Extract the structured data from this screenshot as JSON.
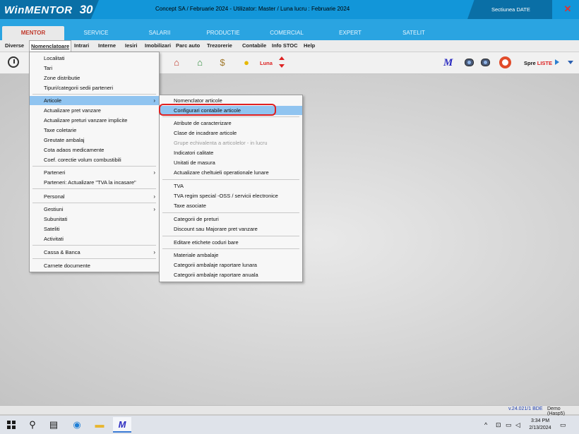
{
  "app": {
    "logo_text": "WinMENTOR",
    "logo_badge": "30",
    "title": "Concept SA / Februarie 2024 - Utilizator: Master / Luna lucru : Februarie 2024",
    "section": "Sectiunea DATE",
    "close_glyph": "✕"
  },
  "modules": [
    "MENTOR",
    "SERVICE",
    "SALARII",
    "PRODUCTIE",
    "COMERCIAL",
    "EXPERT",
    "SATELIT"
  ],
  "menubar": [
    "Diverse",
    "Nomenclatoare",
    "Intrari",
    "Interne",
    "Iesiri",
    "Imobilizari",
    "Parc auto",
    "Trezorerie",
    "Contabile",
    "Info STOC",
    "Help"
  ],
  "toolbar": {
    "luna": "Luna",
    "spre_prefix": "Spre ",
    "spre_accent": "LISTE",
    "icons": [
      "clock-icon",
      "house-icon",
      "house-add-icon",
      "money-bag-icon",
      "lightbulb-icon",
      "m-logo-icon",
      "record-icon",
      "record-icon",
      "lifebuoy-icon"
    ],
    "m_glyph": "M"
  },
  "menu_nomenclatoare": [
    {
      "label": "Localitati"
    },
    {
      "label": "Tari"
    },
    {
      "label": "Zone distributie"
    },
    {
      "label": "Tipuri/categorii sedii parteneri"
    },
    {
      "label": "Articole",
      "arrow": "›",
      "highlight": true
    },
    {
      "label": "Actualizare pret vanzare"
    },
    {
      "label": "Actualizare preturi vanzare implicite"
    },
    {
      "label": "Taxe coletarie"
    },
    {
      "label": "Greutate ambalaj"
    },
    {
      "label": "Cota adaos medicamente"
    },
    {
      "label": "Coef. corectie volum combustibili"
    },
    {
      "label": "Parteneri",
      "arrow": "›"
    },
    {
      "label": "Parteneri: Actualizare \"TVA la incasare\""
    },
    {
      "label": "Personal",
      "arrow": "›"
    },
    {
      "label": "Gestiuni",
      "arrow": "›"
    },
    {
      "label": "Subunitati"
    },
    {
      "label": "Sateliti"
    },
    {
      "label": "Activitati"
    },
    {
      "label": "Cassa & Banca",
      "arrow": "›"
    },
    {
      "label": "Carnete documente"
    }
  ],
  "menu_articole": [
    {
      "label": "Nomenclator articole"
    },
    {
      "label": "Configurari contabile articole",
      "highlight": true
    },
    {
      "label": "Atribute de caracterizare"
    },
    {
      "label": "Clase de incadrare articole"
    },
    {
      "label": "Grupe echivalenta a articolelor - in lucru",
      "disabled": true
    },
    {
      "label": "Indicatori calitate"
    },
    {
      "label": "Unitati de masura"
    },
    {
      "label": "Actualizare cheltuieli operationale lunare"
    },
    {
      "label": "TVA"
    },
    {
      "label": "TVA regim special -OSS / servicii electronice"
    },
    {
      "label": "Taxe asociate"
    },
    {
      "label": "Categorii de preturi"
    },
    {
      "label": "Discount sau Majorare pret vanzare"
    },
    {
      "label": "Editare etichete coduri bare"
    },
    {
      "label": "Materiale ambalaje"
    },
    {
      "label": "Categorii ambalaje raportare lunara"
    },
    {
      "label": "Categorii ambalaje raportare anuala"
    }
  ],
  "status": {
    "version": "v.24.021/1 BDE",
    "demo": "Demo (Hasp5)"
  },
  "taskbar": {
    "time": "3:34 PM",
    "date": "2/13/2024"
  },
  "colors": {
    "title_bar": "#1296d9",
    "accent_red": "#e02020",
    "highlight": "#90c4f0"
  }
}
